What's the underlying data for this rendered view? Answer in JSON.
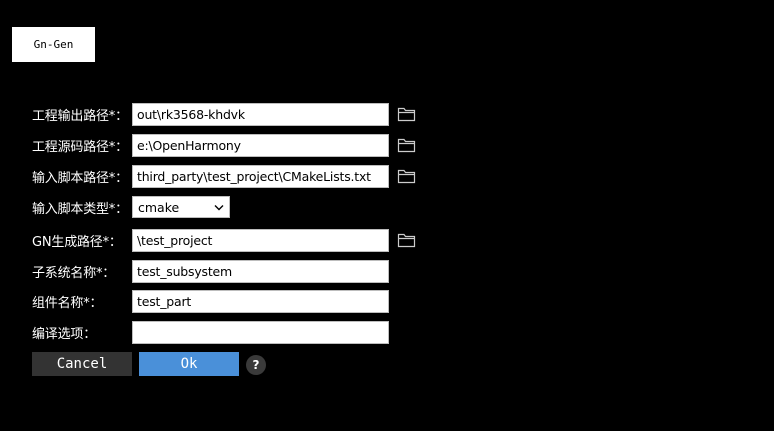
{
  "tab": {
    "label": "Gn-Gen"
  },
  "form": {
    "output_path": {
      "label": "工程输出路径*：",
      "value": "out\\rk3568-khdvk"
    },
    "source_path": {
      "label": "工程源码路径*：",
      "value": "e:\\OpenHarmony"
    },
    "input_script_path": {
      "label": "输入脚本路径*：",
      "value": "third_party\\test_project\\CMakeLists.txt"
    },
    "input_script_type": {
      "label": "输入脚本类型*：",
      "value": "cmake"
    },
    "gn_gen_path": {
      "label": "GN生成路径*：",
      "value": "\\test_project"
    },
    "subsystem_name": {
      "label": "子系统名称*：",
      "value": "test_subsystem"
    },
    "part_name": {
      "label": "组件名称*：",
      "value": "test_part"
    },
    "compile_options": {
      "label": "编译选项：",
      "value": ""
    }
  },
  "buttons": {
    "cancel": "Cancel",
    "ok": "Ok",
    "help": "?"
  },
  "icons": {
    "folder": "folder-icon",
    "chevron": "chevron-down-icon"
  },
  "colors": {
    "background": "#000000",
    "ok_button": "#4a90d9",
    "cancel_button": "#333333"
  }
}
